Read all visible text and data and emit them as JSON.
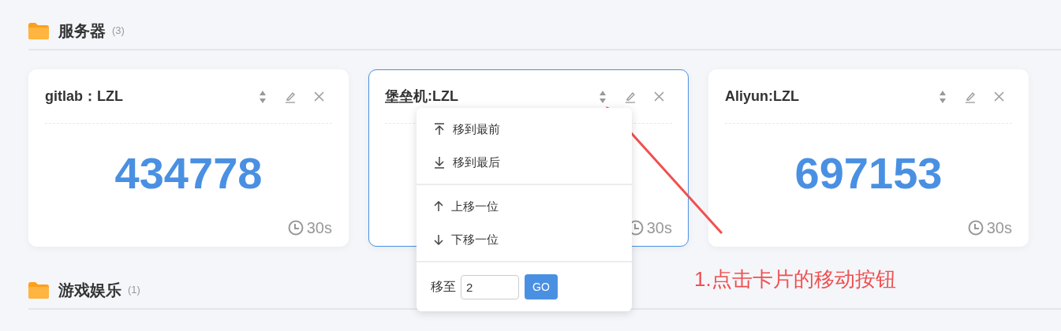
{
  "sections": [
    {
      "title": "服务器",
      "count": "(3)",
      "cards": [
        {
          "title": "gitlab：LZL",
          "value": "434778",
          "refresh": "30s",
          "active": false
        },
        {
          "title": "堡垒机:LZL",
          "refresh": "30s",
          "active": true,
          "menu_open": true
        },
        {
          "title": "Aliyun:LZL",
          "value": "697153",
          "refresh": "30s",
          "active": false
        }
      ]
    },
    {
      "title": "游戏娱乐",
      "count": "(1)"
    }
  ],
  "move_menu": {
    "groups": [
      [
        {
          "kind": "top",
          "label": "移到最前"
        },
        {
          "kind": "bottom",
          "label": "移到最后"
        }
      ],
      [
        {
          "kind": "up",
          "label": "上移一位"
        },
        {
          "kind": "down",
          "label": "下移一位"
        }
      ]
    ],
    "move_to": {
      "label": "移至",
      "value": "2",
      "button": "GO"
    }
  },
  "annotation": {
    "text": "1.点击卡片的移动按钮"
  }
}
